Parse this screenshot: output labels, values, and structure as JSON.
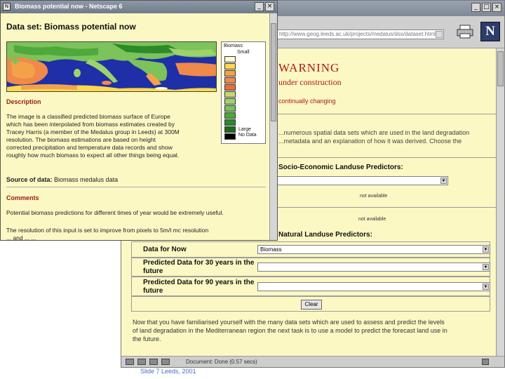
{
  "back_window": {
    "url": "http://www.geog.leeds.ac.uk/projects/medalus/dss/dataset.html",
    "warning_title": "WARNING",
    "warning_sub": "under construction",
    "warning_change": "continually changing",
    "intro_lines": [
      "...numerous spatial data sets which are used in the land degradation",
      "...metadata and an explanation of how it was derived. Choose the"
    ],
    "socio_heading": "Socio-Economic Landuse Predictors:",
    "not_available_1": "not available",
    "not_available_2": "not available",
    "natural_heading": "Natural Landuse Predictors:",
    "rows": [
      {
        "label": "Data for Now",
        "value": "Biomass"
      },
      {
        "label": "Predicted Data for 30 years in the future",
        "value": ""
      },
      {
        "label": "Predicted Data for 90 years in the future",
        "value": ""
      }
    ],
    "clear_label": "Clear",
    "outro_lines": [
      "Now that you have familiarised yourself with the many data sets which are used to assess and predict the levels",
      "of land degradation in the Mediterranean region the next task is to use a model to predict the forecast land use in",
      "the future."
    ],
    "status_text": "Document: Done (0.57 secs)"
  },
  "popup": {
    "window_title": "Biomass potential now - Netscape 6",
    "heading": "Data set: Biomass potential now",
    "legend": {
      "title": "Biomass",
      "small": "Small",
      "large": "Large",
      "no_data": "No Data"
    },
    "legend_colors": [
      "#fdfcd0",
      "#ffd84a",
      "#f4a24a",
      "#ef8a4a",
      "#e86f3a",
      "#c7d86a",
      "#9ed26a",
      "#7bc35a",
      "#4ea83a",
      "#2c8a2a",
      "#1e6a1e",
      "#000000"
    ],
    "description_head": "Description",
    "description_lines": [
      "The image is a classified predicted biomass surface of Europe",
      "which has been interpolated from biomass estimates created by",
      "Tracey Harris (a member of the Medalus group in Leeds) at 300M",
      "resolution. The biomass estimations are based on height",
      "corrected precipitation and temperature data records and show",
      "roughly how much biomass to expect all other things being equal."
    ],
    "source_label": "Source of data:",
    "source_value": "Biomass medalus data",
    "comments_head": "Comments",
    "comment_line": "Potential biomass predictions for different times of year would be extremely useful.",
    "more_lines": [
      "The resolution of this input is set to improve from pixels to 5m/l mc resolution",
      "... and ... ..."
    ]
  },
  "overlay_text": "Slide 7   Leeds, 2001"
}
